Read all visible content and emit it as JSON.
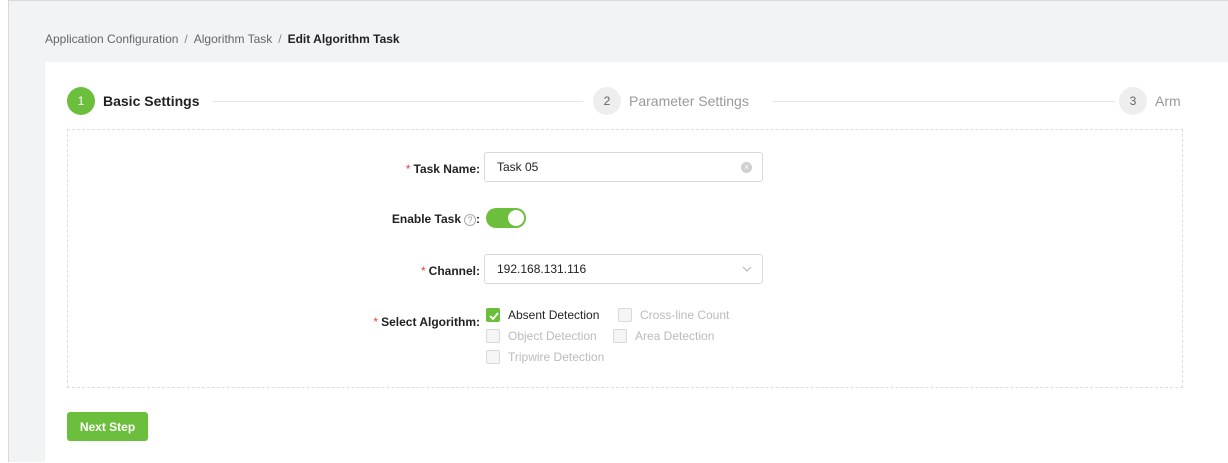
{
  "breadcrumb": {
    "items": [
      "Application Configuration",
      "Algorithm Task",
      "Edit Algorithm Task"
    ],
    "separator": "/"
  },
  "steps": [
    {
      "number": "1",
      "label": "Basic Settings",
      "active": true
    },
    {
      "number": "2",
      "label": "Parameter Settings",
      "active": false
    },
    {
      "number": "3",
      "label": "Arm",
      "active": false
    }
  ],
  "form": {
    "task_name": {
      "label": "Task Name",
      "value": "Task 05",
      "required": true
    },
    "enable_task": {
      "label": "Enable Task",
      "value": true
    },
    "channel": {
      "label": "Channel",
      "value": "192.168.131.116",
      "required": true
    },
    "algorithm": {
      "label": "Select Algorithm",
      "required": true,
      "options": [
        {
          "label": "Absent Detection",
          "checked": true
        },
        {
          "label": "Cross-line Count",
          "checked": false
        },
        {
          "label": "Object Detection",
          "checked": false
        },
        {
          "label": "Area Detection",
          "checked": false
        },
        {
          "label": "Tripwire Detection",
          "checked": false
        }
      ]
    },
    "colon": ":",
    "required_mark": "*",
    "help_glyph": "?"
  },
  "actions": {
    "next_label": "Next Step"
  },
  "colors": {
    "accent": "#6cbf3d",
    "required": "#e8413c"
  },
  "icons": [
    "help-icon",
    "clear-icon",
    "chevron-down-icon",
    "check-icon"
  ]
}
